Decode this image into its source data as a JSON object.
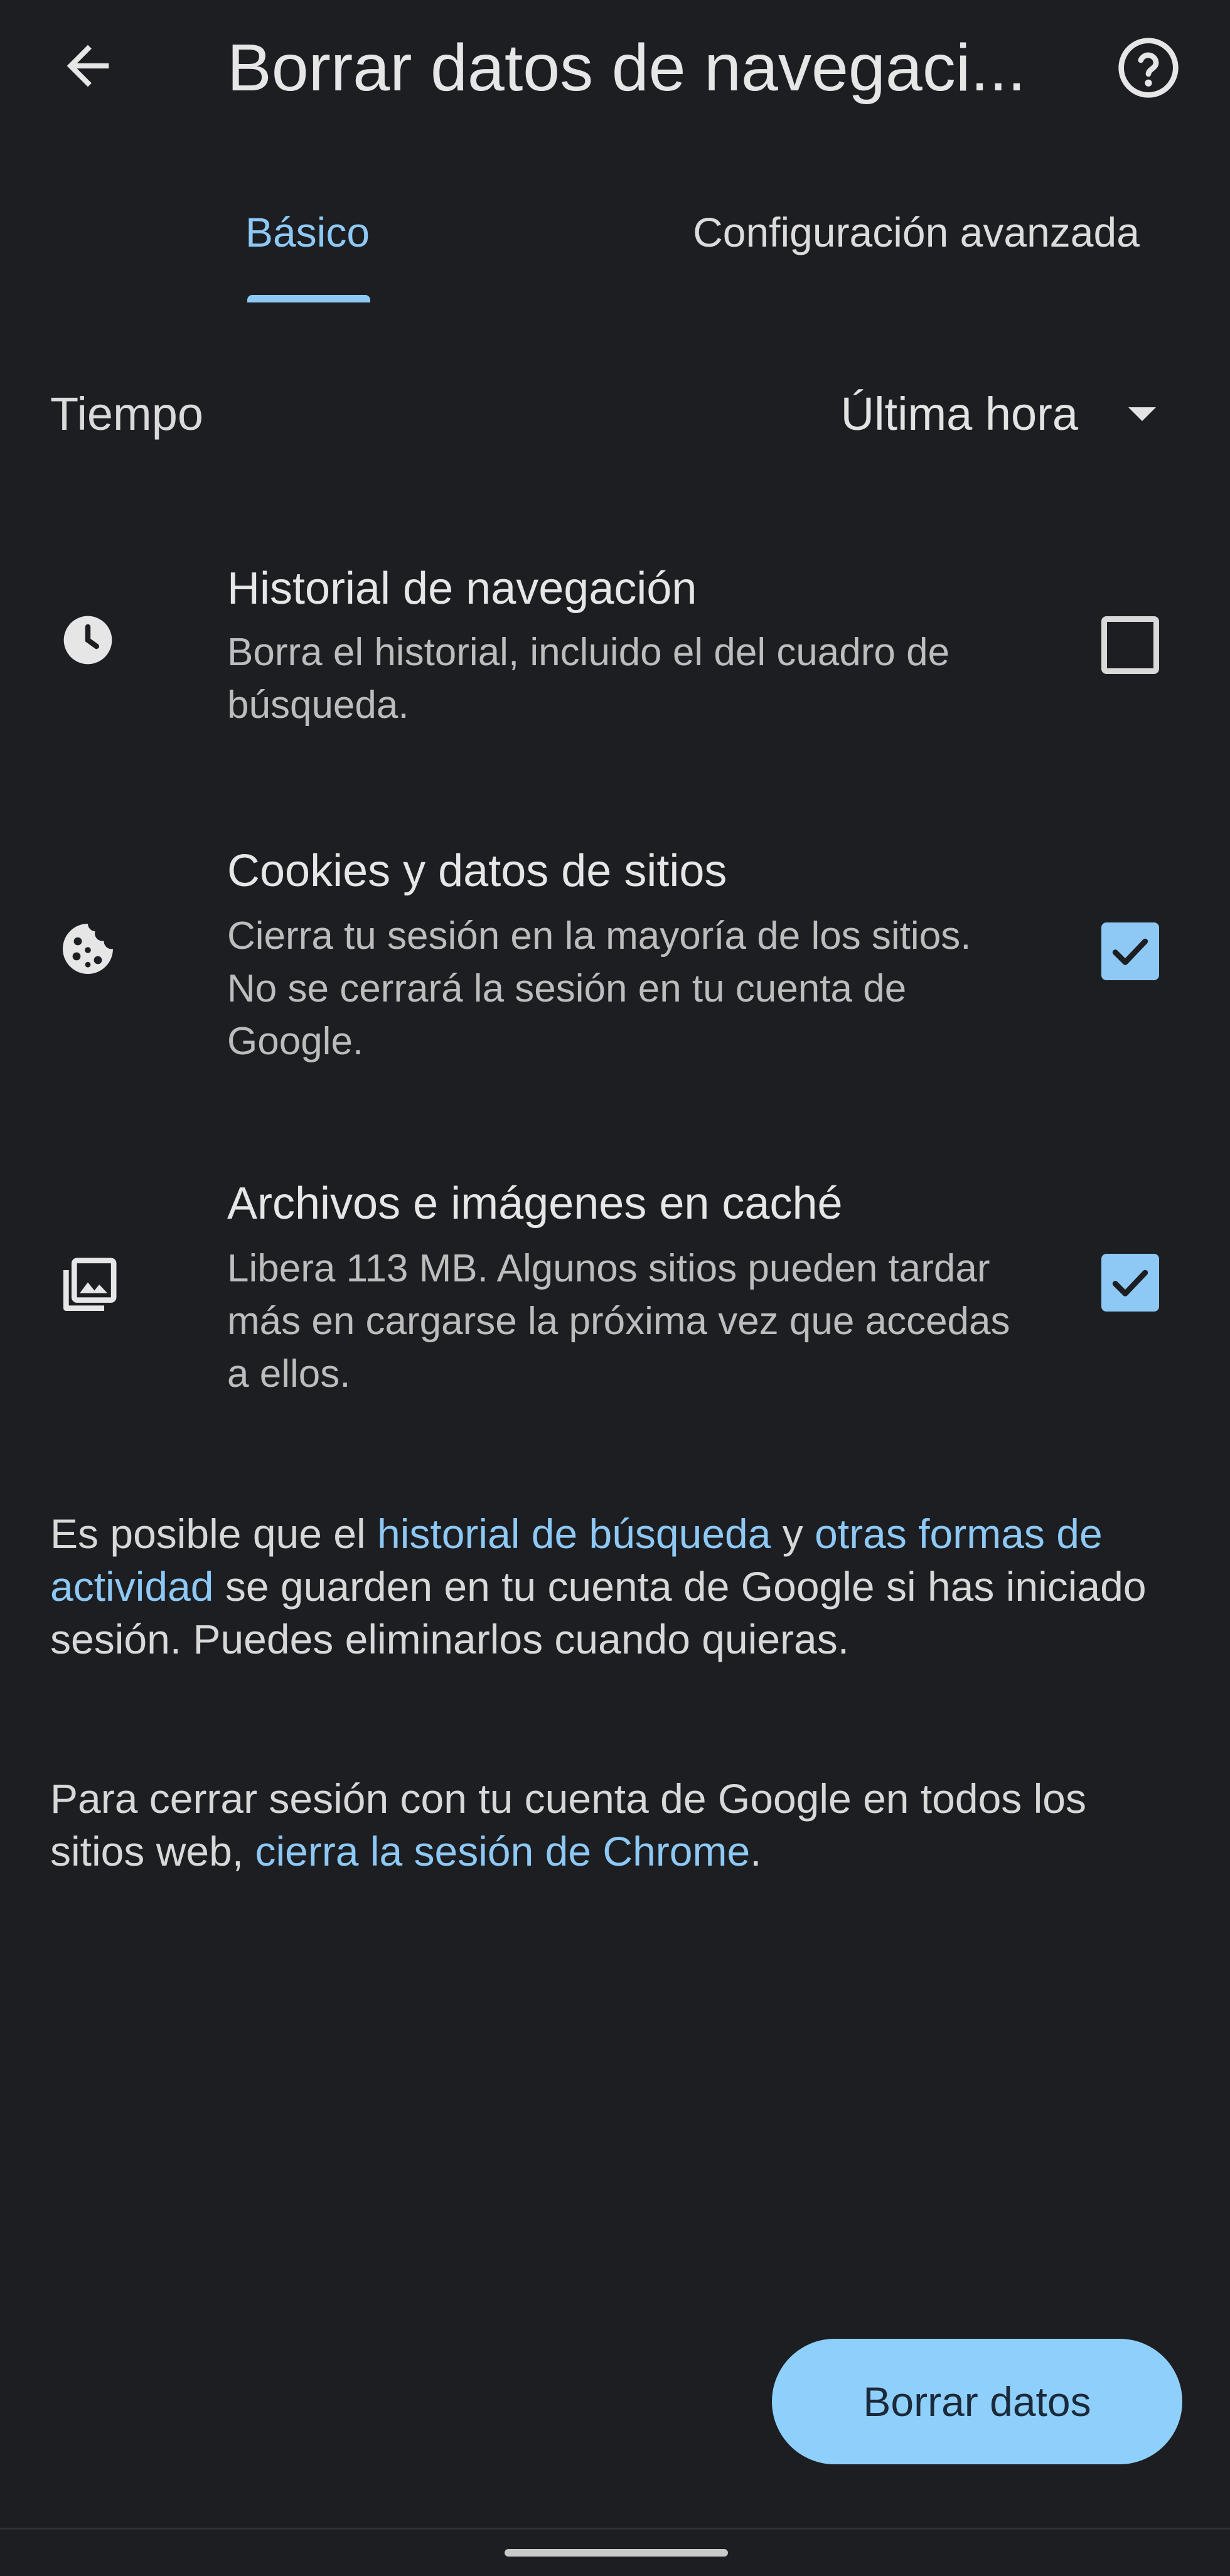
{
  "header": {
    "title": "Borrar datos de navegaci...",
    "back_icon": "arrow-left-icon",
    "help_icon": "help-circle-icon"
  },
  "tabs": [
    {
      "label": "Básico",
      "selected": true
    },
    {
      "label": "Configuración avanzada",
      "selected": false
    }
  ],
  "time_range": {
    "label": "Tiempo",
    "value": "Última hora"
  },
  "options": [
    {
      "icon": "clock-icon",
      "title": "Historial de navegación",
      "description": "Borra el historial, incluido el del cuadro de búsqueda.",
      "checked": false
    },
    {
      "icon": "cookie-icon",
      "title": "Cookies y datos de sitios",
      "description": "Cierra tu sesión en la mayoría de los sitios. No se cerrará la sesión en tu cuenta de Google.",
      "checked": true
    },
    {
      "icon": "image-stack-icon",
      "title": "Archivos e imágenes en caché",
      "description": "Libera 113 MB. Algunos sitios pueden tardar más en cargarse la próxima vez que accedas a ellos.",
      "checked": true
    }
  ],
  "info1": {
    "p1": "Es posible que el ",
    "link1": "historial de búsqueda",
    "p2": " y ",
    "link2": "otras formas de actividad",
    "p3": " se guarden en tu cuenta de Google si has iniciado sesión. Puedes eliminarlos cuando quieras."
  },
  "info2": {
    "p1": "Para cerrar sesión con tu cuenta de Google en todos los sitios web, ",
    "link1": "cierra la sesión de Chrome",
    "p2": "."
  },
  "actions": {
    "clear_label": "Borrar datos"
  },
  "colors": {
    "background": "#1c1e22",
    "accent": "#8ec9f5",
    "button": "#8ed0fb"
  }
}
